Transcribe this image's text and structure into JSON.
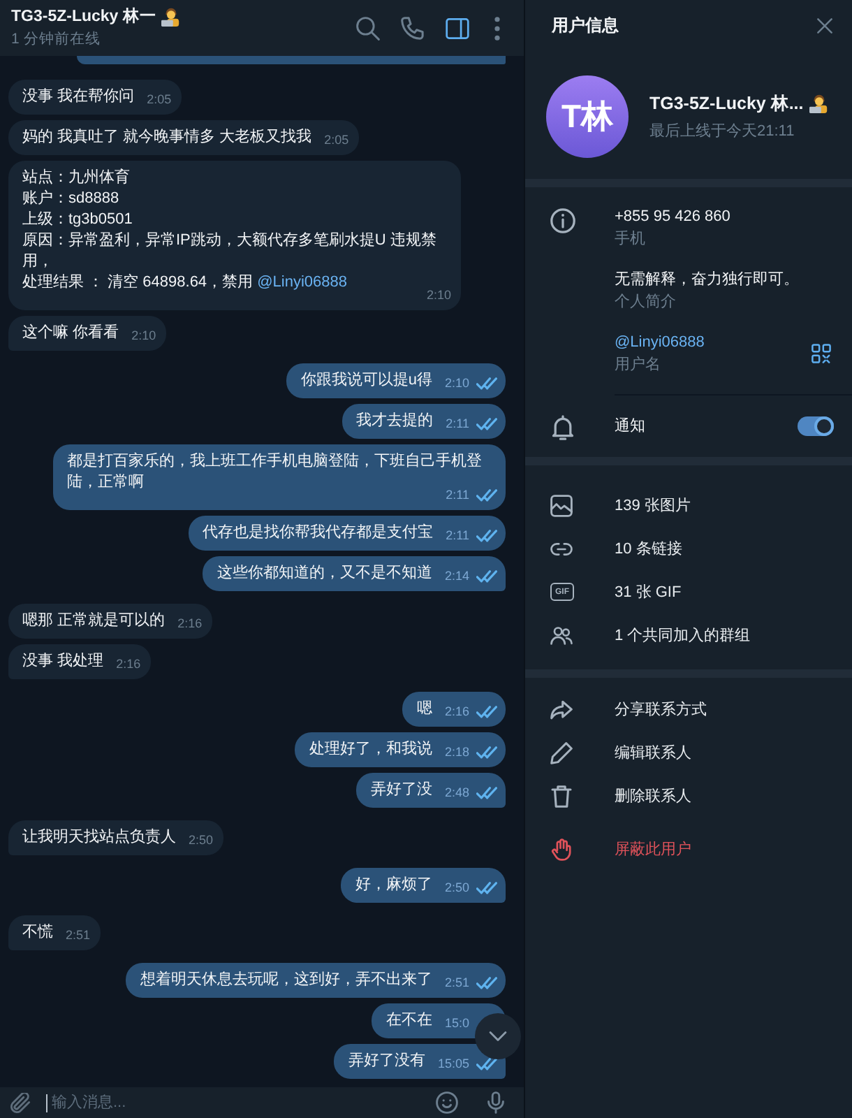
{
  "chat_header": {
    "title": "TG3-5Z-Lucky 林一",
    "status": "1 分钟前在线",
    "buttons": [
      {
        "kind": "search",
        "selected": false
      },
      {
        "kind": "call",
        "selected": false
      },
      {
        "kind": "sidebar",
        "selected": true
      },
      {
        "kind": "more",
        "selected": false
      }
    ]
  },
  "messages": [
    {
      "kind": "partial",
      "outgoing": true
    },
    {
      "kind": "text",
      "outgoing": false,
      "text": "没事 我在帮你问",
      "time": "2:05"
    },
    {
      "kind": "text",
      "outgoing": false,
      "text": "妈的 我真吐了 就今晚事情多 大老板又找我",
      "time": "2:05"
    },
    {
      "kind": "multiline",
      "outgoing": false,
      "lines": [
        "站点：九州体育",
        "账户：sd8888",
        "上级：tg3b0501",
        "原因：异常盈利，异常IP跳动，大额代存多笔刷水提U 违规禁用，",
        "处理结果 ： 清空 64898.64，禁用 "
      ],
      "link": "@Linyi06888",
      "time": "2:10"
    },
    {
      "kind": "text",
      "outgoing": false,
      "text": "这个嘛 你看看",
      "time": "2:10"
    },
    {
      "kind": "text",
      "outgoing": true,
      "text": "你跟我说可以提u得",
      "time": "2:10",
      "read": true
    },
    {
      "kind": "text",
      "outgoing": true,
      "text": "我才去提的",
      "time": "2:11",
      "read": true
    },
    {
      "kind": "text",
      "outgoing": true,
      "text": "都是打百家乐的，我上班工作手机电脑登陆，下班自己手机登陆，正常啊",
      "time": "2:11",
      "read": true
    },
    {
      "kind": "text",
      "outgoing": true,
      "text": "代存也是找你帮我代存都是支付宝",
      "time": "2:11",
      "read": true
    },
    {
      "kind": "text",
      "outgoing": true,
      "text": "这些你都知道的，又不是不知道",
      "time": "2:14",
      "read": true
    },
    {
      "kind": "text",
      "outgoing": false,
      "text": "嗯那 正常就是可以的",
      "time": "2:16"
    },
    {
      "kind": "text",
      "outgoing": false,
      "text": "没事 我处理",
      "time": "2:16"
    },
    {
      "kind": "text",
      "outgoing": true,
      "text": "嗯",
      "time": "2:16",
      "read": true
    },
    {
      "kind": "text",
      "outgoing": true,
      "text": "处理好了，和我说",
      "time": "2:18",
      "read": true
    },
    {
      "kind": "text",
      "outgoing": true,
      "text": "弄好了没",
      "time": "2:48",
      "read": true
    },
    {
      "kind": "text",
      "outgoing": false,
      "text": "让我明天找站点负责人",
      "time": "2:50"
    },
    {
      "kind": "text",
      "outgoing": true,
      "text": "好，麻烦了",
      "time": "2:50",
      "read": true
    },
    {
      "kind": "text",
      "outgoing": false,
      "text": "不慌",
      "time": "2:51"
    },
    {
      "kind": "text",
      "outgoing": true,
      "text": "想着明天休息去玩呢，这到好，弄不出来了",
      "time": "2:51",
      "read": true
    },
    {
      "kind": "text",
      "outgoing": true,
      "text": "在不在",
      "time": "15:0"
    },
    {
      "kind": "text",
      "outgoing": true,
      "text": "弄好了没有",
      "time": "15:05",
      "read": true
    }
  ],
  "composer": {
    "placeholder": "输入消息..."
  },
  "info_panel": {
    "title": "用户信息",
    "profile": {
      "initials": "T林",
      "name": "TG3-5Z-Lucky 林...",
      "last_seen": "最后上线于今天21:11"
    },
    "details": [
      {
        "kind": "phone",
        "value": "+855 95 426 860",
        "label": "手机"
      },
      {
        "kind": "bio",
        "value": "无需解释，奋力独行即可。",
        "label": "个人简介"
      },
      {
        "kind": "username",
        "value": "@Linyi06888",
        "label": "用户名"
      }
    ],
    "notifications": {
      "label": "通知",
      "on": true
    },
    "media": [
      {
        "kind": "photos",
        "label": "139 张图片"
      },
      {
        "kind": "links",
        "label": "10 条链接"
      },
      {
        "kind": "gifs",
        "label": "31 张 GIF",
        "icon_text": "GIF"
      },
      {
        "kind": "groups",
        "label": "1 个共同加入的群组"
      }
    ],
    "actions": [
      {
        "kind": "share",
        "label": "分享联系方式"
      },
      {
        "kind": "edit",
        "label": "编辑联系人"
      },
      {
        "kind": "delete",
        "label": "删除联系人"
      },
      {
        "kind": "block",
        "label": "屏蔽此用户"
      }
    ]
  }
}
